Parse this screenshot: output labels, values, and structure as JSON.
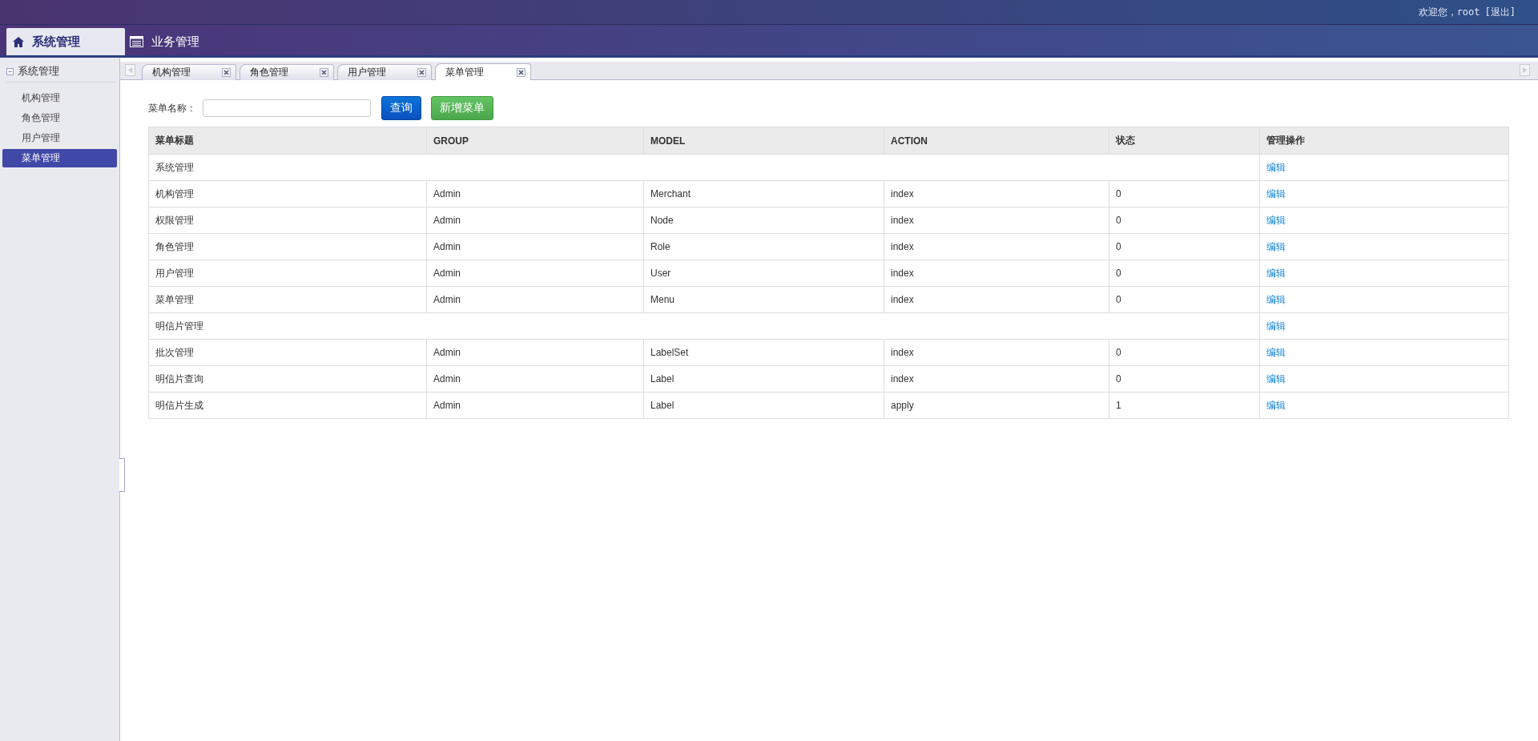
{
  "header": {
    "welcome": "欢迎您，root",
    "logout": "[退出]"
  },
  "nav_tabs": [
    {
      "label": "系统管理",
      "kind": "home",
      "selected": true
    },
    {
      "label": "业务管理",
      "kind": "list",
      "selected": false
    }
  ],
  "sidebar": {
    "title": "系统管理",
    "expanded": true,
    "items": [
      {
        "label": "机构管理",
        "selected": false
      },
      {
        "label": "角色管理",
        "selected": false
      },
      {
        "label": "用户管理",
        "selected": false
      },
      {
        "label": "菜单管理",
        "selected": true
      }
    ]
  },
  "page_tabs": [
    {
      "label": "机构管理",
      "selected": false
    },
    {
      "label": "角色管理",
      "selected": false
    },
    {
      "label": "用户管理",
      "selected": false
    },
    {
      "label": "菜单管理",
      "selected": true
    }
  ],
  "search": {
    "label": "菜单名称：",
    "buttons": [
      {
        "label": "查询",
        "kind": "primary"
      },
      {
        "label": "新增菜单",
        "kind": "success"
      }
    ]
  },
  "table": {
    "columns": [
      "菜单标题",
      "GROUP",
      "MODEL",
      "ACTION",
      "状态",
      "管理操作"
    ],
    "rows": [
      {
        "cells": [
          {
            "text": "系统管理",
            "colspan": 5
          },
          "编辑"
        ]
      },
      {
        "cells": [
          "机构管理",
          "Admin",
          "Merchant",
          "index",
          "0",
          "编辑"
        ]
      },
      {
        "cells": [
          "权限管理",
          "Admin",
          "Node",
          "index",
          "0",
          "编辑"
        ]
      },
      {
        "cells": [
          "角色管理",
          "Admin",
          "Role",
          "index",
          "0",
          "编辑"
        ]
      },
      {
        "cells": [
          "用户管理",
          "Admin",
          "User",
          "index",
          "0",
          "编辑"
        ]
      },
      {
        "cells": [
          "菜单管理",
          "Admin",
          "Menu",
          "index",
          "0",
          "编辑"
        ]
      },
      {
        "cells": [
          {
            "text": "明信片管理",
            "colspan": 5
          },
          "编辑"
        ]
      },
      {
        "cells": [
          "批次管理",
          "Admin",
          "LabelSet",
          "index",
          "0",
          "编辑"
        ]
      },
      {
        "cells": [
          "明信片查询",
          "Admin",
          "Label",
          "index",
          "0",
          "编辑"
        ]
      },
      {
        "cells": [
          "明信片生成",
          "Admin",
          "Label",
          "apply",
          "1",
          "编辑"
        ]
      }
    ]
  }
}
